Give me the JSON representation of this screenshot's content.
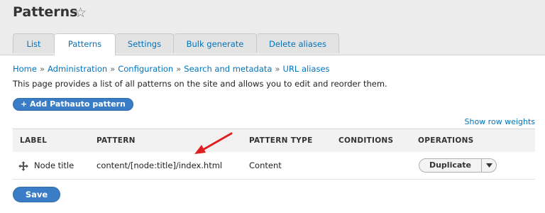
{
  "page": {
    "title": "Patterns"
  },
  "tabs": [
    {
      "label": "List"
    },
    {
      "label": "Patterns",
      "active": true
    },
    {
      "label": "Settings"
    },
    {
      "label": "Bulk generate"
    },
    {
      "label": "Delete aliases"
    }
  ],
  "breadcrumb": [
    "Home",
    "Administration",
    "Configuration",
    "Search and metadata",
    "URL aliases"
  ],
  "breadcrumb_separator": "»",
  "description": "This page provides a list of all patterns on the site and allows you to edit and reorder them.",
  "add_button_label": "+ Add Pathauto pattern",
  "row_weights_label": "Show row weights",
  "table": {
    "headers": [
      "LABEL",
      "PATTERN",
      "PATTERN TYPE",
      "CONDITIONS",
      "OPERATIONS"
    ],
    "rows": [
      {
        "label": "Node title",
        "pattern": "content/[node:title]/index.html",
        "pattern_type": "Content",
        "conditions": "",
        "operation_label": "Duplicate"
      }
    ]
  },
  "save_label": "Save",
  "colors": {
    "link": "#0074bd",
    "primary_button": "#3a7dc6",
    "annotation_arrow": "#e02020"
  }
}
